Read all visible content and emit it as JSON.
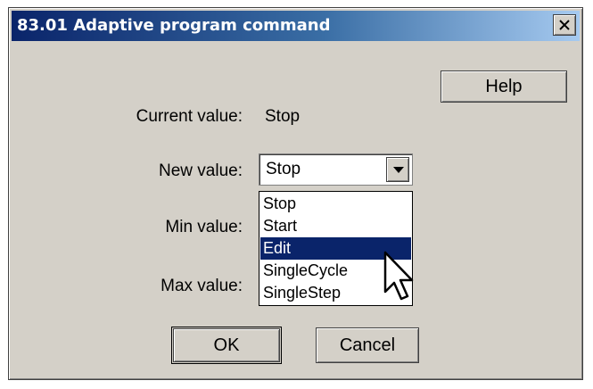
{
  "window": {
    "title": "83.01 Adaptive program command",
    "close_glyph": "✕"
  },
  "buttons": {
    "help": "Help",
    "ok": "OK",
    "cancel": "Cancel"
  },
  "fields": {
    "current_label": "Current value:",
    "current_value": "Stop",
    "new_label": "New value:",
    "new_value": "Stop",
    "min_label": "Min value:",
    "max_label": "Max value:"
  },
  "dropdown": {
    "options": [
      "Stop",
      "Start",
      "Edit",
      "SingleCycle",
      "SingleStep"
    ],
    "highlighted": "Edit"
  },
  "colors": {
    "title_bar_start": "#0a246a",
    "title_bar_end": "#a6caf0",
    "selection": "#0a246a",
    "face": "#d4d0c8"
  },
  "icons": {
    "close": "close-icon",
    "dropdown_arrow": "chevron-down-icon",
    "cursor": "mouse-pointer-icon"
  }
}
